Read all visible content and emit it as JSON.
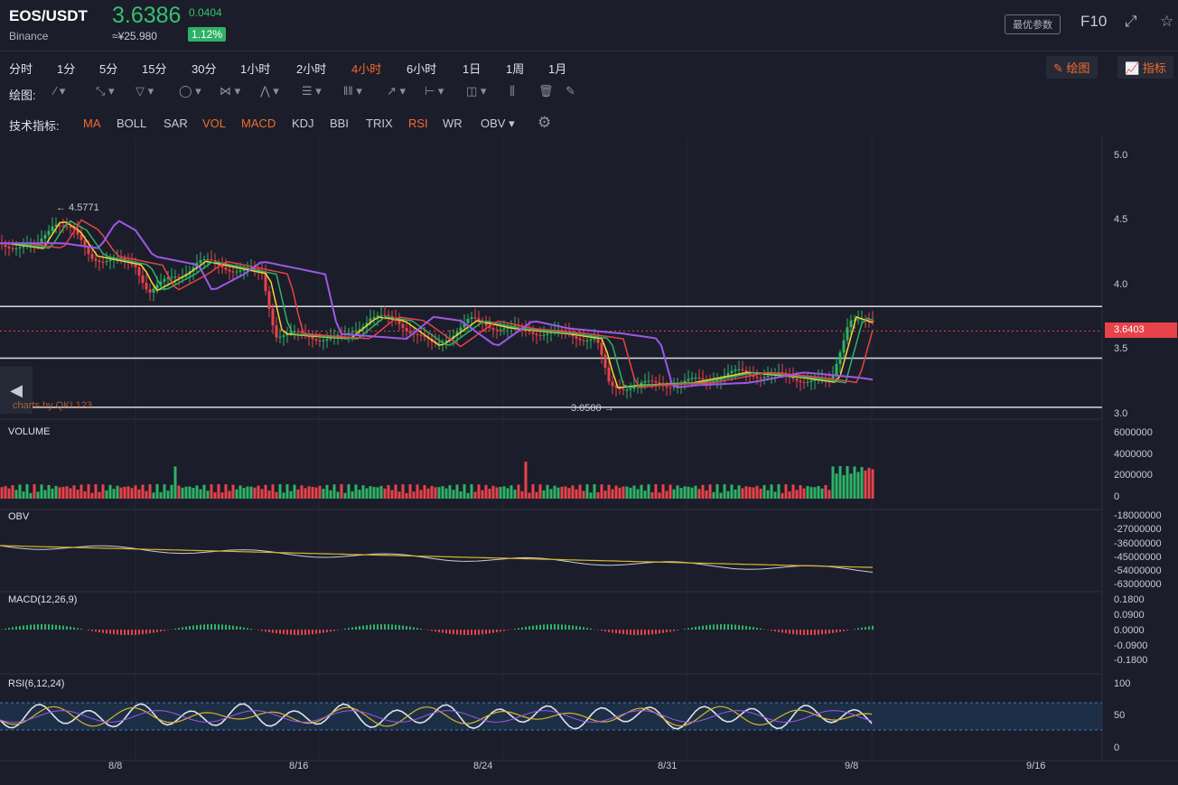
{
  "header": {
    "pair": "EOS/USDT",
    "exchange": "Binance",
    "price": "3.6386",
    "change": "0.0404",
    "cny": "≈¥25.980",
    "change_pct": "1.12%",
    "param_button": "最优参数",
    "f10": "F10",
    "expand_icon": "⤢",
    "star_icon": "☆"
  },
  "timeframes": [
    "分时",
    "1分",
    "5分",
    "15分",
    "30分",
    "1小时",
    "2小时",
    "4小时",
    "6小时",
    "1日",
    "1周",
    "1月"
  ],
  "active_timeframe": "4小时",
  "toolbar_right": {
    "draw": "✎ 绘图",
    "indicators": "📈 指标"
  },
  "drawing": {
    "label": "绘图:"
  },
  "indicators": {
    "label": "技术指标:",
    "items": [
      "MA",
      "BOLL",
      "SAR",
      "VOL",
      "MACD",
      "KDJ",
      "BBI",
      "TRIX",
      "RSI",
      "WR",
      "OBV ▾"
    ],
    "active": [
      "MA",
      "VOL",
      "MACD",
      "RSI"
    ]
  },
  "chart": {
    "price_axis": [
      "5.0",
      "4.5",
      "4.0",
      "3.5",
      "3.0"
    ],
    "current_price_tag": "3.6403",
    "high_label": "← 4.5771",
    "low_label": "3.0500 →",
    "credit": "charts by QKL123",
    "panels": {
      "volume": "VOLUME",
      "obv": "OBV",
      "macd": "MACD(12,26,9)",
      "rsi": "RSI(6,12,24)"
    },
    "volume_axis": [
      "6000000",
      "4000000",
      "2000000",
      "0"
    ],
    "obv_axis": [
      "-18000000",
      "-27000000",
      "-36000000",
      "-45000000",
      "-54000000",
      "-63000000"
    ],
    "macd_axis": [
      "0.1800",
      "0.0900",
      "0.0000",
      "-0.0900",
      "-0.1800"
    ],
    "rsi_axis": [
      "100",
      "50",
      "0"
    ],
    "dates": [
      "8/8",
      "8/16",
      "8/24",
      "8/31",
      "9/8",
      "9/16"
    ],
    "colors": {
      "up": "#2fb267",
      "down": "#e8424a",
      "ma1": "#f5d532",
      "ma2": "#2fb267",
      "ma3": "#e8424a",
      "ma4": "#9b59e6"
    }
  }
}
